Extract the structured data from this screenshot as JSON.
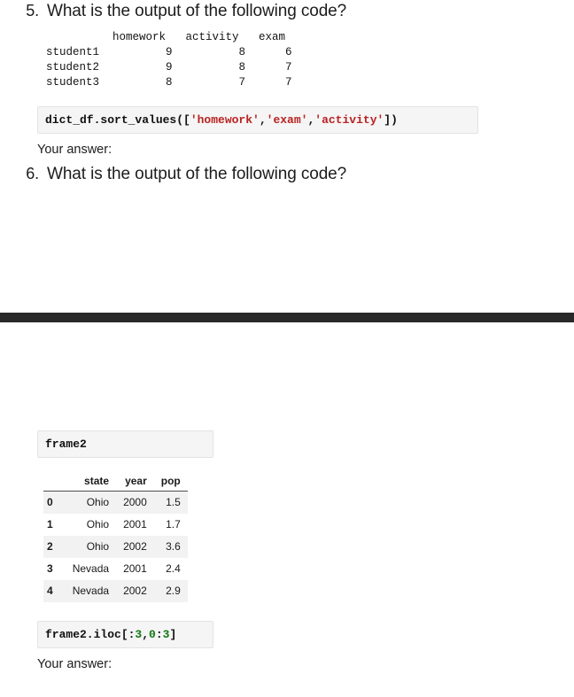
{
  "page": {
    "background_color": "#ffffff",
    "divider_color": "#292929"
  },
  "questions": [
    {
      "number": "5.",
      "text": "What is the output of the following code?",
      "answer_label": "Your answer:"
    },
    {
      "number": "6.",
      "text": "What is the output of the following code?",
      "answer_label": "Your answer:"
    }
  ],
  "text_output": {
    "header_row": "          homework   activity   exam",
    "rows": [
      "student1          9          8      6",
      "student2          9          8      7",
      "student3          8          7      7"
    ],
    "columns": [
      "homework",
      "activity",
      "exam"
    ],
    "index": [
      "student1",
      "student2",
      "student3"
    ],
    "values": [
      [
        9,
        8,
        6
      ],
      [
        9,
        8,
        7
      ],
      [
        8,
        7,
        7
      ]
    ]
  },
  "code_q5": {
    "parts": [
      {
        "type": "name",
        "text": "dict_df.sort_values(["
      },
      {
        "type": "str",
        "text": "'homework'"
      },
      {
        "type": "op",
        "text": ","
      },
      {
        "type": "str",
        "text": "'exam'"
      },
      {
        "type": "op",
        "text": ","
      },
      {
        "type": "str",
        "text": "'activity'"
      },
      {
        "type": "op",
        "text": "])"
      }
    ],
    "plain": "dict_df.sort_values(['homework','exam','activity'])"
  },
  "frame2_label": {
    "plain": "frame2"
  },
  "frame2_table": {
    "index_header": "",
    "columns": [
      "state",
      "year",
      "pop"
    ],
    "rows": [
      {
        "index": "0",
        "state": "Ohio",
        "year": "2000",
        "pop": "1.5"
      },
      {
        "index": "1",
        "state": "Ohio",
        "year": "2001",
        "pop": "1.7"
      },
      {
        "index": "2",
        "state": "Ohio",
        "year": "2002",
        "pop": "3.6"
      },
      {
        "index": "3",
        "state": "Nevada",
        "year": "2001",
        "pop": "2.4"
      },
      {
        "index": "4",
        "state": "Nevada",
        "year": "2002",
        "pop": "2.9"
      }
    ]
  },
  "code_q6": {
    "parts": [
      {
        "type": "name",
        "text": "frame2.iloc[:"
      },
      {
        "type": "num",
        "text": "3"
      },
      {
        "type": "op",
        "text": ","
      },
      {
        "type": "num",
        "text": "0"
      },
      {
        "type": "op",
        "text": ":"
      },
      {
        "type": "num",
        "text": "3"
      },
      {
        "type": "op",
        "text": "]"
      }
    ],
    "plain": "frame2.iloc[:3,0:3]"
  }
}
